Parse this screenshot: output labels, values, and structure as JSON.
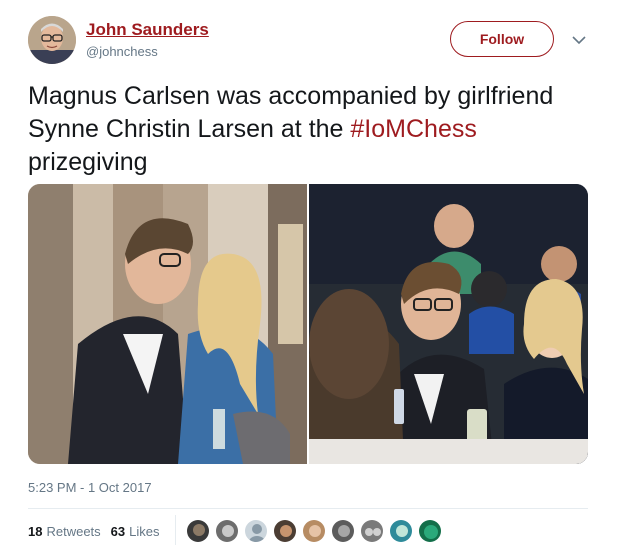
{
  "author": {
    "name": "John Saunders",
    "handle": "@johnchess"
  },
  "follow_label": "Follow",
  "tweet": {
    "text_before": "Magnus Carlsen was accompanied by girlfriend Synne Christin Larsen at the ",
    "hashtag": "#IoMChess",
    "text_after": " prizegiving"
  },
  "timestamp": "5:23 PM - 1 Oct 2017",
  "stats": {
    "retweets_count": "18",
    "retweets_label": "Retweets",
    "likes_count": "63",
    "likes_label": "Likes"
  },
  "colors": {
    "accent": "#9e1b1f",
    "secondary_text": "#657786",
    "divider": "#e6ecf0"
  },
  "icons": {
    "more": "chevron-down-icon"
  }
}
